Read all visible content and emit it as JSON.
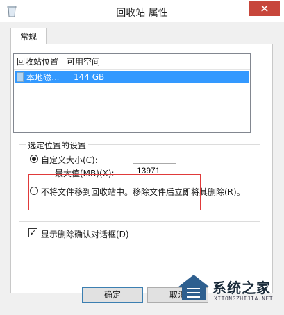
{
  "window": {
    "title": "回收站 属性",
    "close_glyph": "✕",
    "title_icon": "recycle-bin-icon"
  },
  "tabs": [
    {
      "label": "常规"
    }
  ],
  "listview": {
    "columns": [
      "回收站位置",
      "可用空间"
    ],
    "rows": [
      {
        "location": "本地磁...",
        "free_space": "144 GB",
        "icon": "drive-icon",
        "selected": true
      }
    ]
  },
  "settings": {
    "group_title": "选定位置的设置",
    "custom_size_label": "自定义大小(C):",
    "max_label": "最大值(MB)(X):",
    "max_value": "13971",
    "no_recycle_label": "不将文件移到回收站中。移除文件后立即将其删除(R)。",
    "selected_option": "custom_size"
  },
  "confirm_dialog": {
    "label": "显示删除确认对话框(D)",
    "checked": true
  },
  "buttons": {
    "ok": "确定",
    "cancel": "取消"
  },
  "watermark": {
    "text": "系统之家",
    "sub": "XITONGZHIJIA.NET"
  },
  "colors": {
    "selection": "#3399ff",
    "close": "#c7463b",
    "annotation": "#e03a3a"
  }
}
